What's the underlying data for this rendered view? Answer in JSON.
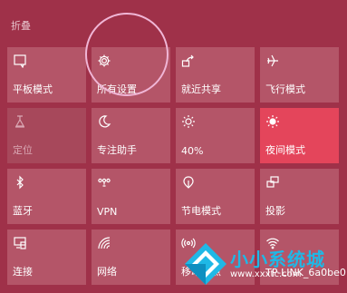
{
  "header": {
    "collapse_label": "折叠"
  },
  "tiles": [
    {
      "label": "平板模式",
      "icon": "tablet-mode-icon",
      "state": "normal"
    },
    {
      "label": "所有设置",
      "icon": "gear-icon",
      "state": "normal"
    },
    {
      "label": "就近共享",
      "icon": "nearby-share-icon",
      "state": "normal"
    },
    {
      "label": "飞行模式",
      "icon": "airplane-icon",
      "state": "normal"
    },
    {
      "label": "定位",
      "icon": "location-icon",
      "state": "disabled"
    },
    {
      "label": "专注助手",
      "icon": "moon-icon",
      "state": "normal"
    },
    {
      "label": "40%",
      "icon": "brightness-icon",
      "state": "normal"
    },
    {
      "label": "夜间模式",
      "icon": "night-light-icon",
      "state": "active"
    },
    {
      "label": "蓝牙",
      "icon": "bluetooth-icon",
      "state": "normal"
    },
    {
      "label": "VPN",
      "icon": "vpn-icon",
      "state": "normal"
    },
    {
      "label": "节电模式",
      "icon": "battery-saver-icon",
      "state": "normal"
    },
    {
      "label": "投影",
      "icon": "project-icon",
      "state": "normal"
    },
    {
      "label": "连接",
      "icon": "connect-icon",
      "state": "normal"
    },
    {
      "label": "网络",
      "icon": "network-icon",
      "state": "normal"
    },
    {
      "label": "移动热点",
      "icon": "mobile-hotspot-icon",
      "state": "normal"
    },
    {
      "label": "TP-LINK_6a0be0",
      "icon": "wifi-icon",
      "state": "normal"
    }
  ],
  "watermark": {
    "text": "小小系统城",
    "url": "www.xxxtc.com"
  },
  "colors": {
    "background": "#9f3149",
    "tile": "#b45568",
    "tile_disabled": "#a7485b",
    "tile_active": "#e4455b",
    "highlight_circle": "#f0b6d6",
    "watermark_text": "#1fb8e6"
  }
}
